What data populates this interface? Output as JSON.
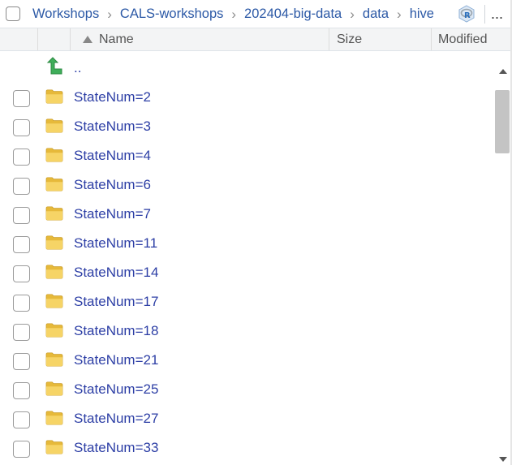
{
  "breadcrumb": {
    "items": [
      "Workshops",
      "CALS-workshops",
      "202404-big-data",
      "data",
      "hive"
    ],
    "separator": "›",
    "more_label": "..."
  },
  "header": {
    "name": "Name",
    "size": "Size",
    "modified": "Modified",
    "sort": "ascending"
  },
  "parent_entry": {
    "label": ".."
  },
  "files": [
    {
      "name": "StateNum=2"
    },
    {
      "name": "StateNum=3"
    },
    {
      "name": "StateNum=4"
    },
    {
      "name": "StateNum=6"
    },
    {
      "name": "StateNum=7"
    },
    {
      "name": "StateNum=11"
    },
    {
      "name": "StateNum=14"
    },
    {
      "name": "StateNum=17"
    },
    {
      "name": "StateNum=18"
    },
    {
      "name": "StateNum=21"
    },
    {
      "name": "StateNum=25"
    },
    {
      "name": "StateNum=27"
    },
    {
      "name": "StateNum=33"
    }
  ],
  "colors": {
    "link": "#2c3ea5",
    "breadcrumb": "#2c59a6",
    "folder": "#f3cb4b",
    "up_arrow": "#3fae5a"
  }
}
